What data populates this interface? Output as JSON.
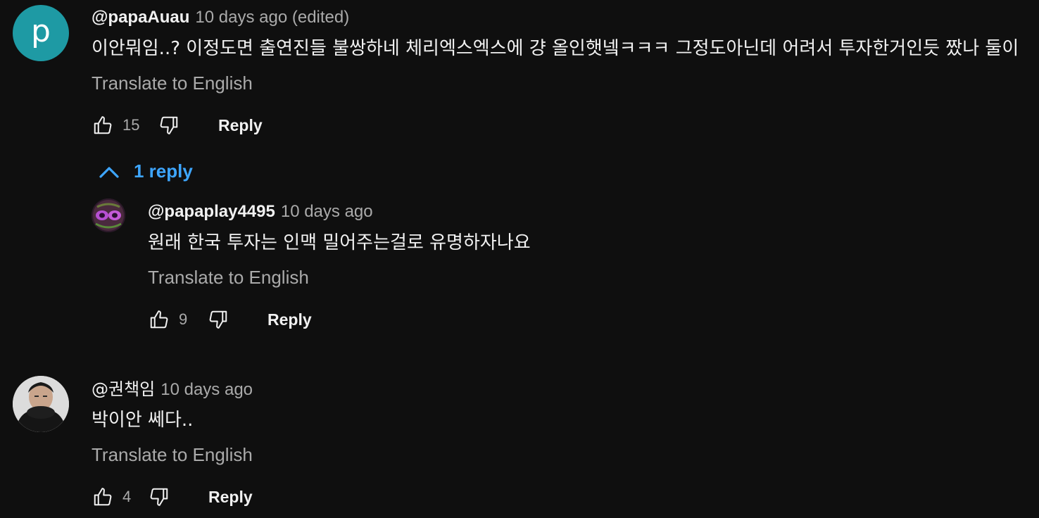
{
  "comments": [
    {
      "avatar_letter": "p",
      "author": "@papaAuau",
      "meta": "10 days ago (edited)",
      "text": "이안뭐임..? 이정도면 출연진들 불쌍하네 체리엑스엑스에 걍 올인햇넼ㅋㅋㅋ 그정도아닌데 어려서 투자한거인듯 짰나 둘이",
      "translate": "Translate to English",
      "likes": "15",
      "reply_label": "Reply",
      "replies_toggle": "1 reply",
      "replies": [
        {
          "author": "@papaplay4495",
          "meta": "10 days ago",
          "text": "원래 한국 투자는 인맥 밀어주는걸로 유명하자나요",
          "translate": "Translate to English",
          "likes": "9",
          "reply_label": "Reply"
        }
      ]
    },
    {
      "author": "@권책임",
      "meta": "10 days ago",
      "text": "박이안 쎄다..",
      "translate": "Translate to English",
      "likes": "4",
      "reply_label": "Reply"
    }
  ],
  "colors": {
    "background": "#0f0f0f",
    "link_blue": "#3ea6ff",
    "avatar_teal": "#1e9aa4",
    "muted_text": "#aaaaaa"
  },
  "icons": [
    "like-icon",
    "dislike-icon",
    "chevron-up-icon"
  ]
}
